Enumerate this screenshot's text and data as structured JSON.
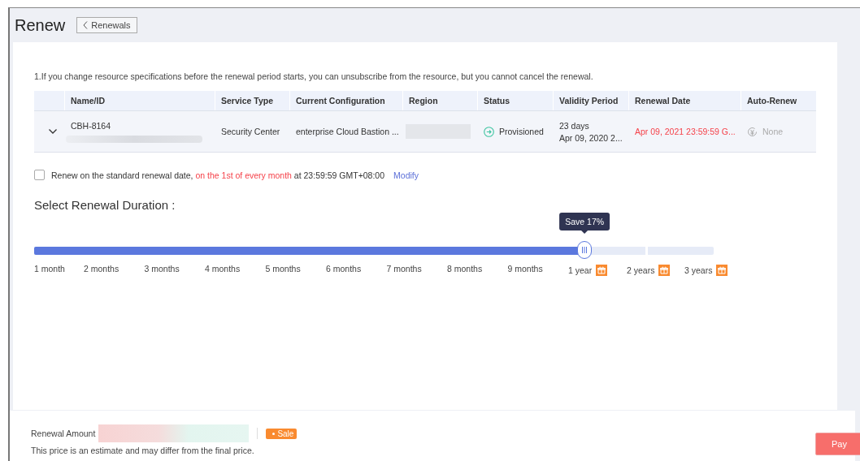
{
  "header": {
    "title": "Renew",
    "back_button": "Renewals"
  },
  "notice": "1.If you change resource specifications before the renewal period starts, you can unsubscribe from the resource, but you cannot cancel the renewal.",
  "table": {
    "columns": [
      "Name/ID",
      "Service Type",
      "Current Configuration",
      "Region",
      "Status",
      "Validity Period",
      "Renewal Date",
      "Auto-Renew"
    ],
    "rows": [
      {
        "expanded": false,
        "name": "CBH-8164",
        "service_type": "Security Center",
        "configuration": "enterprise Cloud Bastion ...",
        "status": "Provisioned",
        "validity": [
          "23 days",
          "Apr 09, 2020 2..."
        ],
        "renewal_date": "Apr 09, 2021 23:59:59 G...",
        "auto_renew": "None"
      }
    ]
  },
  "standard_date": {
    "checked": false,
    "parts": [
      {
        "kind": "plain",
        "text": "Renew on the standard renewal date, "
      },
      {
        "kind": "highlight",
        "text": "on the 1st of every month"
      },
      {
        "kind": "plain",
        "text": " at 23:59:59 GMT+08:00"
      }
    ],
    "link": "Modify"
  },
  "duration": {
    "title": "Select Renewal Duration :",
    "level": 0.81,
    "tooltip": "Save 17%",
    "options": [
      {
        "label": "1 month",
        "gift": false
      },
      {
        "label": "2 months",
        "gift": false
      },
      {
        "label": "3 months",
        "gift": false
      },
      {
        "label": "4 months",
        "gift": false
      },
      {
        "label": "5 months",
        "gift": false
      },
      {
        "label": "6 months",
        "gift": false
      },
      {
        "label": "7 months",
        "gift": false
      },
      {
        "label": "8 months",
        "gift": false
      },
      {
        "label": "9 months",
        "gift": false
      },
      {
        "label": "1 year",
        "gift": true
      },
      {
        "label": "2 years",
        "gift": true
      },
      {
        "label": "3 years",
        "gift": true
      }
    ]
  },
  "footer": {
    "amount_label": "Renewal Amount",
    "tag": "Sale",
    "note": "This price is an estimate and may differ from the final price.",
    "pay_button": "Pay"
  }
}
